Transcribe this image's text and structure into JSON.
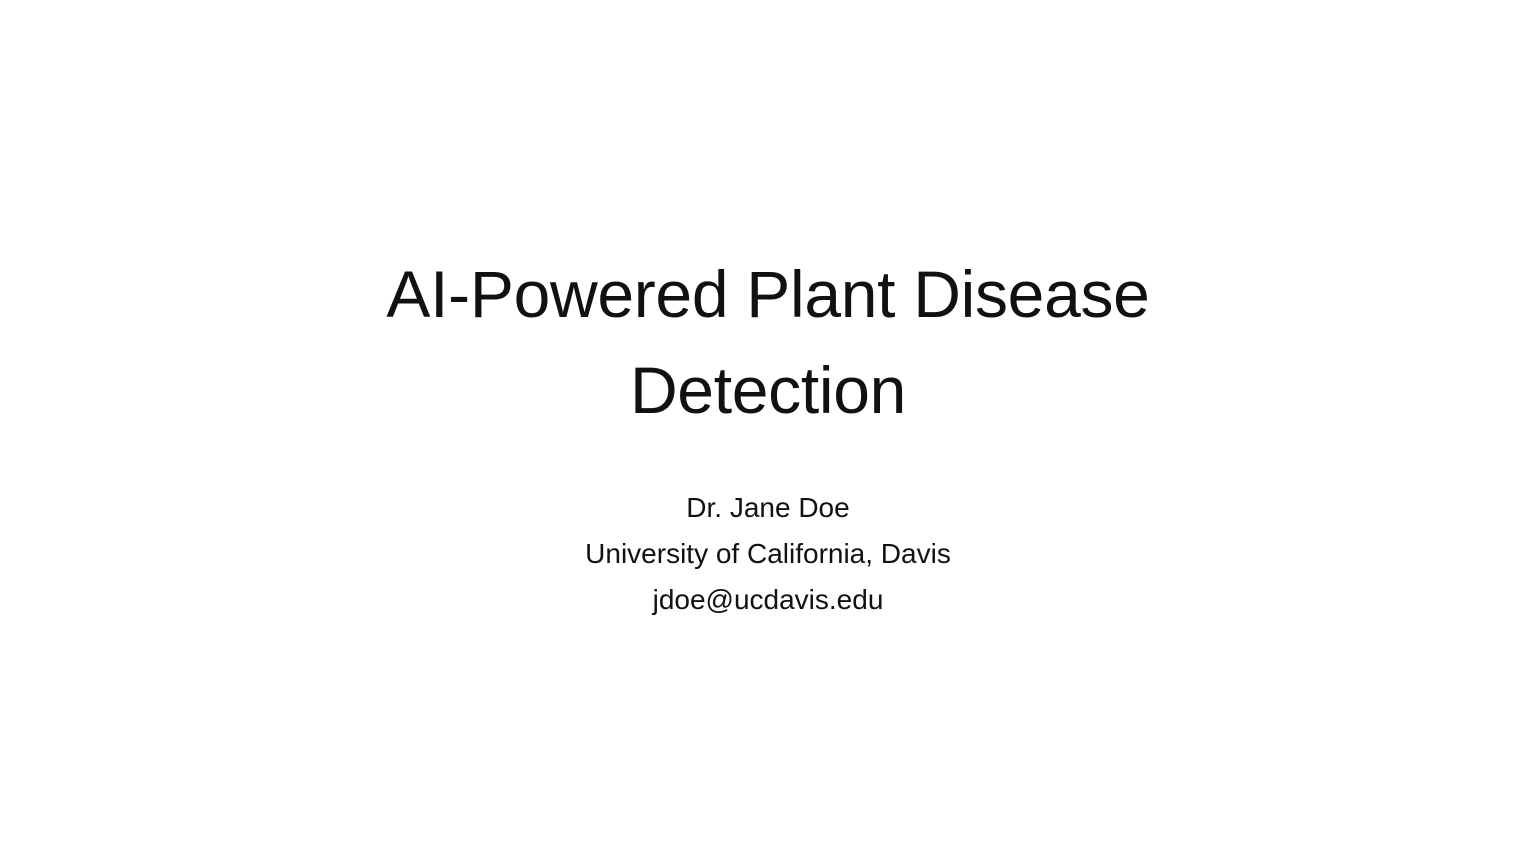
{
  "slide": {
    "title_lines": [
      "AI-Powered Plant Disease",
      "Detection"
    ],
    "subtitle_lines": [
      "Dr. Jane Doe",
      "University of California, Davis",
      "jdoe@ucdavis.edu"
    ]
  }
}
